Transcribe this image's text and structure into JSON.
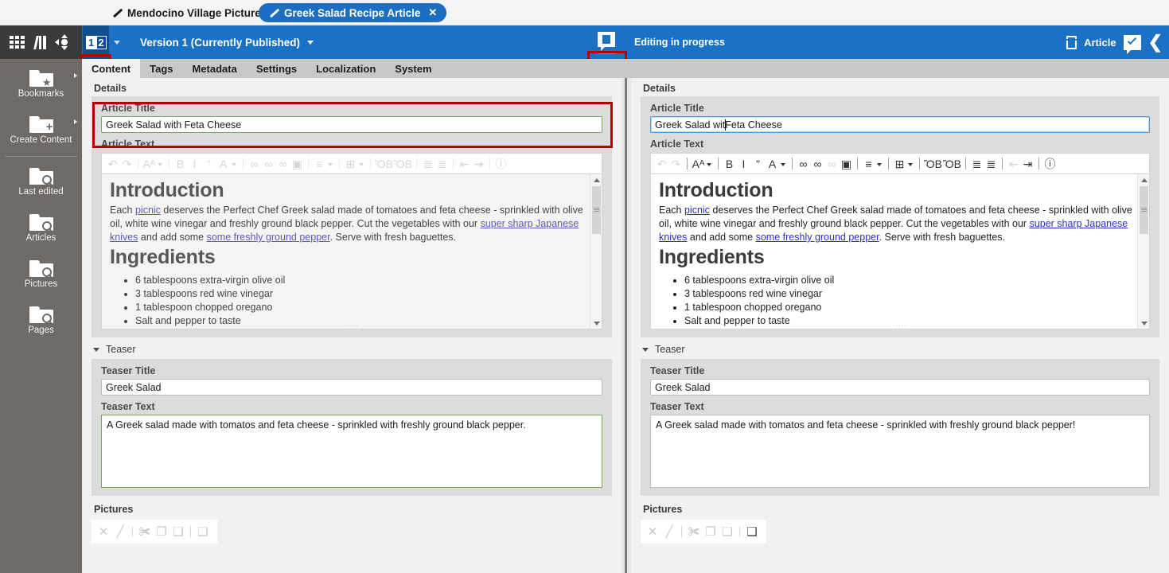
{
  "tabstrip": {
    "tabs": [
      {
        "label": "Mendocino Village Picture",
        "active": false,
        "icon": "pencil-icon"
      },
      {
        "label": "Greek Salad Recipe Article",
        "active": true,
        "icon": "pencil-icon",
        "close": "✕"
      }
    ]
  },
  "toolbar": {
    "left_icons": [
      "grid-icon",
      "library-icon",
      "navigate-icon"
    ],
    "compare_button": {
      "label_left": "1",
      "label_right": "2",
      "highlighted": true
    },
    "version_label": "Version 1 (Currently Published)",
    "status_icon": "editing-in-progress-icon",
    "status_text": "Editing in progress",
    "content_type_icon": "document-icon",
    "content_type_label": "Article",
    "approve_icon": "check-bubble-icon",
    "collapse_icon": "chevron-left-icon",
    "accent_blue": "#1b72c4",
    "dark_bar": "#3b3b3b",
    "compare_active_bg": "#0d4f8f",
    "highlight_red": "#b50000"
  },
  "tabrow": {
    "tabs": [
      {
        "label": "Content",
        "selected": true
      },
      {
        "label": "Tags",
        "selected": false
      },
      {
        "label": "Metadata",
        "selected": false
      },
      {
        "label": "Settings",
        "selected": false
      },
      {
        "label": "Localization",
        "selected": false
      },
      {
        "label": "System",
        "selected": false
      }
    ]
  },
  "sidebar": {
    "items": [
      {
        "label": "Bookmarks",
        "icon": "folder-star-icon",
        "has_arrow": true
      },
      {
        "label": "Create Content",
        "icon": "folder-plus-icon",
        "has_arrow": true
      },
      {
        "label": "Last edited",
        "icon": "folder-search-icon",
        "has_arrow": false
      },
      {
        "label": "Articles",
        "icon": "folder-search-icon",
        "has_arrow": false
      },
      {
        "label": "Pictures",
        "icon": "folder-search-icon",
        "has_arrow": false
      },
      {
        "label": "Pages",
        "icon": "folder-search-icon",
        "has_arrow": false
      }
    ]
  },
  "left_panel": {
    "details_header": "Details",
    "article_title_label": "Article Title",
    "article_title_value": "Greek Salad with Feta Cheese",
    "article_title_highlighted": true,
    "article_text_label": "Article Text",
    "editor_enabled": false,
    "teaser_header": "Teaser",
    "teaser_title_label": "Teaser Title",
    "teaser_title_value": "Greek Salad",
    "teaser_text_label": "Teaser Text",
    "teaser_text_value": "A Greek salad made with tomatos and feta cheese - sprinkled with freshly ground black pepper.",
    "pictures_label": "Pictures"
  },
  "right_panel": {
    "details_header": "Details",
    "article_title_label": "Article Title",
    "article_title_before_caret": "Greek Salad wit",
    "article_title_after_caret": "Feta Cheese",
    "article_text_label": "Article Text",
    "editor_enabled": true,
    "teaser_header": "Teaser",
    "teaser_title_label": "Teaser Title",
    "teaser_title_value": "Greek Salad",
    "teaser_text_label": "Teaser Text",
    "teaser_text_value": "A Greek salad made with tomatos and feta cheese - sprinkled with freshly ground black pepper!",
    "pictures_label": "Pictures"
  },
  "article_body": {
    "heading_1": "Introduction",
    "paragraph_parts": [
      {
        "type": "text",
        "value": "Each "
      },
      {
        "type": "link",
        "value": "picnic"
      },
      {
        "type": "text",
        "value": " deserves the Perfect Chef Greek salad made of tomatoes and feta cheese - sprinkled with olive oil, white wine vinegar and freshly ground black pepper. Cut the vegetables with our "
      },
      {
        "type": "link",
        "value": "super sharp Japanese knives"
      },
      {
        "type": "text",
        "value": " and add some "
      },
      {
        "type": "link",
        "value": "some freshly ground pepper"
      },
      {
        "type": "text",
        "value": ". Serve with fresh baguettes."
      }
    ],
    "heading_2": "Ingredients",
    "ingredients": [
      "6 tablespoons extra-virgin olive oil",
      "3 tablespoons red wine vinegar",
      "1 tablespoon chopped oregano",
      "Salt and pepper to taste"
    ]
  },
  "rte_toolbar_items": [
    {
      "name": "undo-icon",
      "glyph": "↶",
      "dim": true
    },
    {
      "name": "redo-icon",
      "glyph": "↷",
      "dim": true
    },
    {
      "sep": true
    },
    {
      "name": "font-style-icon",
      "glyph": "Aᴬ",
      "dim": false,
      "caret": true
    },
    {
      "sep": true
    },
    {
      "name": "bold-icon",
      "glyph": "B",
      "dim": false
    },
    {
      "name": "italic-icon",
      "glyph": "I",
      "dim": false
    },
    {
      "name": "quote-icon",
      "glyph": "”",
      "dim": false
    },
    {
      "name": "text-color-icon",
      "glyph": "A",
      "dim": false,
      "caret": true
    },
    {
      "sep": true
    },
    {
      "name": "insert-link-icon",
      "glyph": "∞",
      "dim": false
    },
    {
      "name": "edit-link-icon",
      "glyph": "∞",
      "dim": false
    },
    {
      "name": "remove-link-icon",
      "glyph": "∞",
      "dim": true
    },
    {
      "name": "insert-image-icon",
      "glyph": "▣",
      "dim": false
    },
    {
      "sep": true
    },
    {
      "name": "align-icon",
      "glyph": "≡",
      "dim": false,
      "caret": true
    },
    {
      "sep": true
    },
    {
      "name": "table-icon",
      "glyph": "⊞",
      "dim": false,
      "caret": true
    },
    {
      "sep": true
    },
    {
      "name": "paste-text-icon",
      "glyph": "ὌB",
      "dim": false
    },
    {
      "name": "paste-word-icon",
      "glyph": "ὌB",
      "dim": false
    },
    {
      "sep": true
    },
    {
      "name": "numbered-list-icon",
      "glyph": "≣",
      "dim": false
    },
    {
      "name": "bullet-list-icon",
      "glyph": "≣",
      "dim": false
    },
    {
      "sep": true
    },
    {
      "name": "outdent-icon",
      "glyph": "⇤",
      "dim": true
    },
    {
      "name": "indent-icon",
      "glyph": "⇥",
      "dim": false
    },
    {
      "sep": true
    },
    {
      "name": "info-icon",
      "glyph": "ⓘ",
      "dim": false
    }
  ],
  "picture_toolbar_items": [
    {
      "name": "delete-icon",
      "glyph": "✕",
      "active": false
    },
    {
      "name": "edit-icon",
      "glyph": "╱",
      "active": false
    },
    {
      "sep": true
    },
    {
      "name": "cut-icon",
      "glyph": "✀",
      "active": false
    },
    {
      "name": "copy-icon",
      "glyph": "❐",
      "active": false
    },
    {
      "name": "paste-icon",
      "glyph": "❑",
      "active": false
    },
    {
      "sep": true
    },
    {
      "name": "add-picture-icon",
      "glyph": "❑",
      "active": false
    }
  ]
}
